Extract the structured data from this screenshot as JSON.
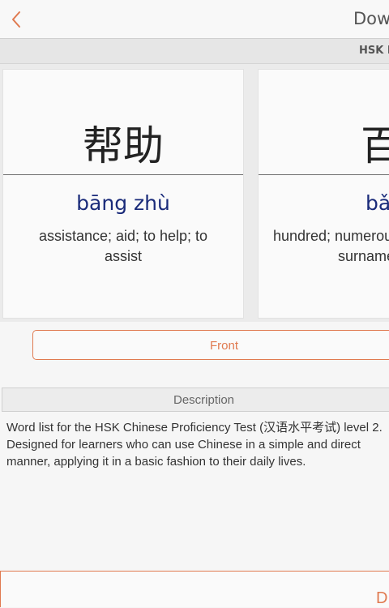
{
  "header": {
    "title": "Dow",
    "back_icon": "chevron-left-icon",
    "accent": "#e07a50"
  },
  "level_bar": {
    "label": "HSK L"
  },
  "cards": [
    {
      "hanzi": "帮助",
      "pinyin": "bāng zhù",
      "meaning": "assistance; aid; to help; to assist"
    },
    {
      "hanzi": "百",
      "pinyin": "bǎ",
      "meaning_line1": "hundred; numerou",
      "meaning_line2": "surname"
    }
  ],
  "controls": {
    "front_label": "Front"
  },
  "description": {
    "title": "Description",
    "line1": "Word list for the HSK Chinese Proficiency Test (汉语水平考试) level 2.",
    "line2": "Designed for learners who can use Chinese in a simple and direct",
    "line3": "manner, applying it in a basic fashion to their daily lives."
  },
  "bottom": {
    "label": "D"
  },
  "colors": {
    "accent": "#e07a50",
    "pinyin": "#1a2b7a"
  }
}
